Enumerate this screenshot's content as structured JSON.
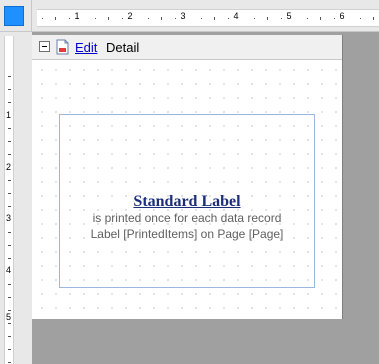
{
  "horizontal_ruler": {
    "labels": [
      "1",
      "2",
      "3",
      "4",
      "5",
      "6"
    ]
  },
  "vertical_ruler": {
    "labels": [
      "1",
      "2",
      "3",
      "4",
      "5"
    ]
  },
  "band": {
    "edit_link": "Edit",
    "title": "Detail"
  },
  "label": {
    "title": "Standard Label",
    "line1": "is printed once for each data record",
    "line2": "Label [PrintedItems] on Page [Page]"
  }
}
